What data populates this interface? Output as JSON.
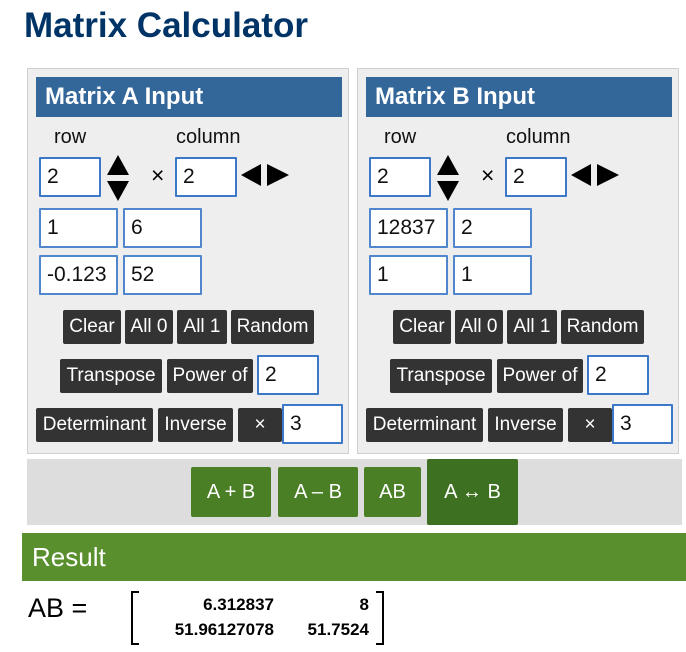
{
  "page_title": "Matrix Calculator",
  "matrix_a": {
    "header": "Matrix A Input",
    "row_label": "row",
    "column_label": "column",
    "rows": "2",
    "columns": "2",
    "times_sign": "×",
    "cells": [
      [
        "1",
        "6"
      ],
      [
        "-0.123",
        "52"
      ]
    ],
    "buttons": {
      "clear": "Clear",
      "all0": "All 0",
      "all1": "All 1",
      "random": "Random",
      "transpose": "Transpose",
      "power_of": "Power of",
      "power_value": "2",
      "determinant": "Determinant",
      "inverse": "Inverse",
      "multiply": "×",
      "multiply_value": "3"
    }
  },
  "matrix_b": {
    "header": "Matrix B Input",
    "row_label": "row",
    "column_label": "column",
    "rows": "2",
    "columns": "2",
    "times_sign": "×",
    "cells": [
      [
        "12837",
        "2"
      ],
      [
        "1",
        "1"
      ]
    ],
    "buttons": {
      "clear": "Clear",
      "all0": "All 0",
      "all1": "All 1",
      "random": "Random",
      "transpose": "Transpose",
      "power_of": "Power of",
      "power_value": "2",
      "determinant": "Determinant",
      "inverse": "Inverse",
      "multiply": "×",
      "multiply_value": "3"
    }
  },
  "operations": {
    "add": "A + B",
    "subtract": "A – B",
    "multiply": "AB",
    "swap": "A ↔ B",
    "selected": "swap"
  },
  "result": {
    "header": "Result",
    "label": "AB =",
    "matrix": [
      [
        "6.312837",
        "8"
      ],
      [
        "51.96127078",
        "51.7524"
      ]
    ]
  },
  "colors": {
    "title": "#003366",
    "panel_header": "#336699",
    "input_border": "#3c78c8",
    "dark_button": "#333333",
    "green_button": "#4a7f26",
    "result_bar": "#5a8f2e"
  },
  "icons": {
    "row_stepper": "up-down-arrows-icon",
    "column_stepper": "left-right-arrows-icon"
  }
}
